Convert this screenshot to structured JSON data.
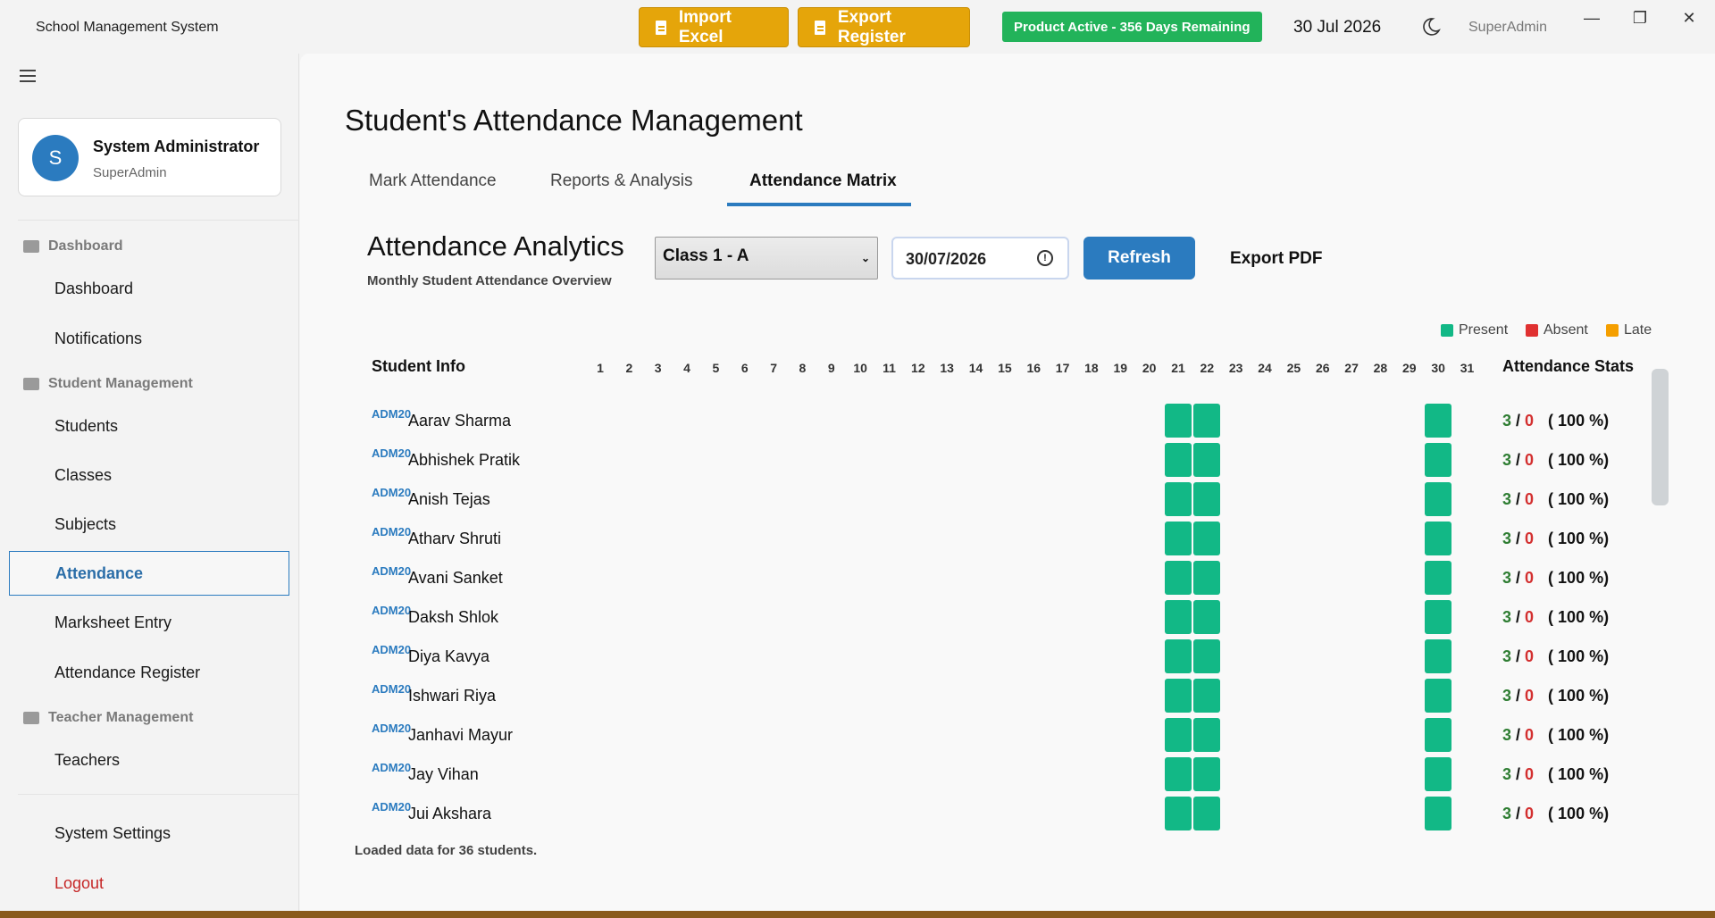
{
  "app": {
    "title": "School Management System",
    "date": "30 Jul 2026",
    "user": "SuperAdmin",
    "license": "Product Active - 356 Days Remaining"
  },
  "toolbar": {
    "import_label": "Import Excel",
    "export_label": "Export Register"
  },
  "window": {
    "minimize": "—",
    "maximize": "❐",
    "close": "✕"
  },
  "sidebar": {
    "user_name": "System Administrator",
    "user_role": "SuperAdmin",
    "avatar_letter": "S",
    "sections": {
      "dashboard": "Dashboard",
      "student_mgmt": "Student Management",
      "teacher_mgmt": "Teacher Management"
    },
    "items": {
      "dashboard": "Dashboard",
      "notifications": "Notifications",
      "students": "Students",
      "classes": "Classes",
      "subjects": "Subjects",
      "attendance": "Attendance",
      "marksheet": "Marksheet Entry",
      "att_register": "Attendance Register",
      "teachers": "Teachers",
      "settings": "System Settings",
      "logout": "Logout"
    }
  },
  "main": {
    "page_title": "Student's Attendance Management",
    "tabs": [
      "Mark Attendance",
      "Reports & Analysis",
      "Attendance Matrix"
    ],
    "analytics_title": "Attendance Analytics",
    "analytics_subtitle": "Monthly Student Attendance Overview",
    "class_selected": "Class 1 - A",
    "date_value": "30/07/2026",
    "refresh_label": "Refresh",
    "export_pdf_label": "Export PDF",
    "legend": {
      "present": "Present",
      "absent": "Absent",
      "late": "Late"
    },
    "colors": {
      "present": "#12b886",
      "absent": "#e03131",
      "late": "#f59f00",
      "accent": "#2b7bbf"
    },
    "col_info": "Student Info",
    "col_stats": "Attendance Stats",
    "days": [
      "1",
      "2",
      "3",
      "4",
      "5",
      "6",
      "7",
      "8",
      "9",
      "10",
      "11",
      "12",
      "13",
      "14",
      "15",
      "16",
      "17",
      "18",
      "19",
      "20",
      "21",
      "22",
      "23",
      "24",
      "25",
      "26",
      "27",
      "28",
      "29",
      "30",
      "31"
    ],
    "present_days": [
      21,
      22,
      30
    ],
    "students": [
      {
        "adm": "ADM20",
        "name": "Aarav Sharma",
        "present": "3",
        "absent": "0",
        "pct": "( 100 %)"
      },
      {
        "adm": "ADM20",
        "name": "Abhishek Pratik",
        "present": "3",
        "absent": "0",
        "pct": "( 100 %)"
      },
      {
        "adm": "ADM20",
        "name": "Anish Tejas",
        "present": "3",
        "absent": "0",
        "pct": "( 100 %)"
      },
      {
        "adm": "ADM20",
        "name": "Atharv Shruti",
        "present": "3",
        "absent": "0",
        "pct": "( 100 %)"
      },
      {
        "adm": "ADM20",
        "name": "Avani Sanket",
        "present": "3",
        "absent": "0",
        "pct": "( 100 %)"
      },
      {
        "adm": "ADM20",
        "name": "Daksh Shlok",
        "present": "3",
        "absent": "0",
        "pct": "( 100 %)"
      },
      {
        "adm": "ADM20",
        "name": "Diya Kavya",
        "present": "3",
        "absent": "0",
        "pct": "( 100 %)"
      },
      {
        "adm": "ADM20",
        "name": "Ishwari Riya",
        "present": "3",
        "absent": "0",
        "pct": "( 100 %)"
      },
      {
        "adm": "ADM20",
        "name": "Janhavi Mayur",
        "present": "3",
        "absent": "0",
        "pct": "( 100 %)"
      },
      {
        "adm": "ADM20",
        "name": "Jay Vihan",
        "present": "3",
        "absent": "0",
        "pct": "( 100 %)"
      },
      {
        "adm": "ADM20",
        "name": "Jui Akshara",
        "present": "3",
        "absent": "0",
        "pct": "( 100 %)"
      }
    ],
    "status": "Loaded data for 36 students."
  }
}
